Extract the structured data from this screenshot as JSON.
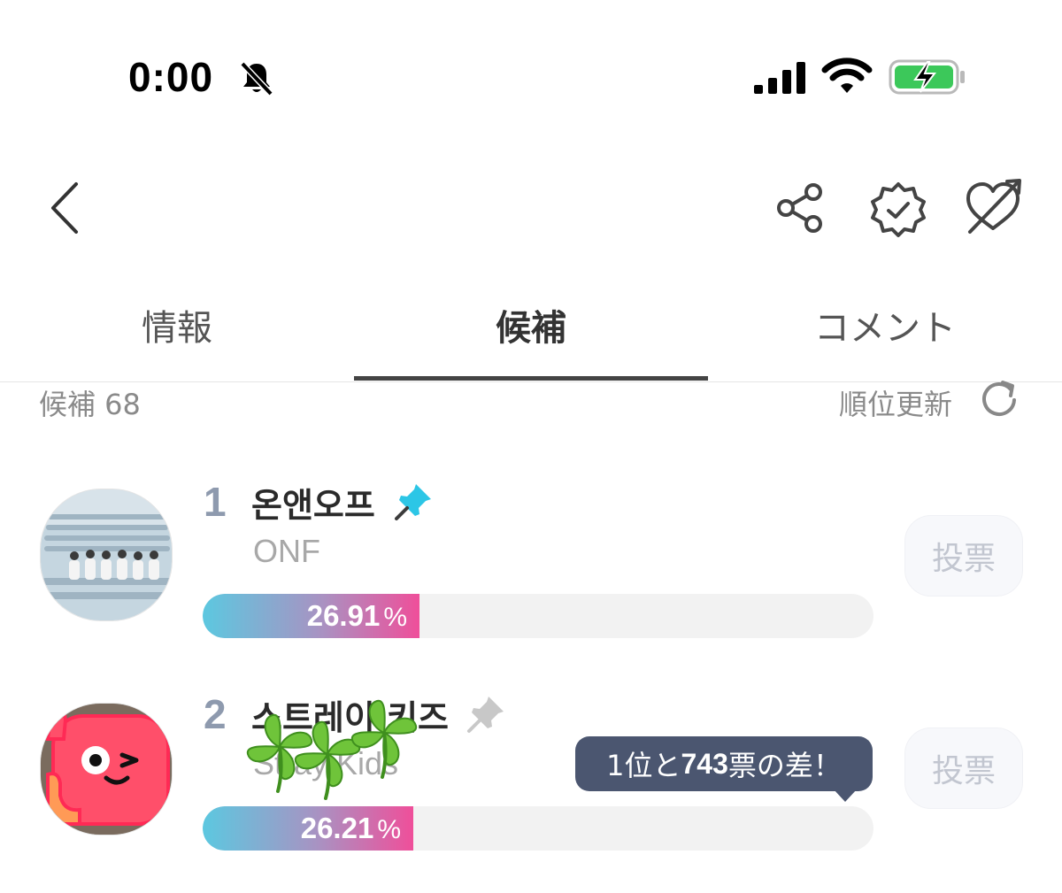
{
  "status_bar": {
    "time": "0:00",
    "icons": [
      "bell-slash-icon",
      "signal-icon",
      "wifi-icon",
      "battery-charging-icon"
    ]
  },
  "header": {
    "icons": [
      "back-icon",
      "share-icon",
      "verified-badge-icon",
      "heart-arrow-icon"
    ]
  },
  "tabs": [
    {
      "label": "情報",
      "active": false
    },
    {
      "label": "候補",
      "active": true
    },
    {
      "label": "コメント",
      "active": false
    }
  ],
  "list_header": {
    "count_label": "候補 68",
    "refresh_label": "順位更新"
  },
  "candidates": [
    {
      "rank": "1",
      "name": "온앤오프",
      "subname": "ONF",
      "percent_value": "26.91",
      "percent_sign": "%",
      "share": 0.2691,
      "pinned": true,
      "vote_label": "投票"
    },
    {
      "rank": "2",
      "name": "스트레이 키즈",
      "subname": "Stray Kids",
      "percent_value": "26.21",
      "percent_sign": "%",
      "share": 0.2621,
      "pinned": false,
      "vote_label": "投票"
    }
  ],
  "tooltip": {
    "prefix": "1位と",
    "votes": "743",
    "suffix": "票の差！"
  },
  "colors": {
    "pin_active": "#2cc6e6",
    "pin_inactive": "#c8c8c8",
    "bar_start": "#5cc8e0",
    "bar_end": "#ef4f9a",
    "tooltip_bg": "#4b5670",
    "battery_green": "#3cc85a"
  }
}
